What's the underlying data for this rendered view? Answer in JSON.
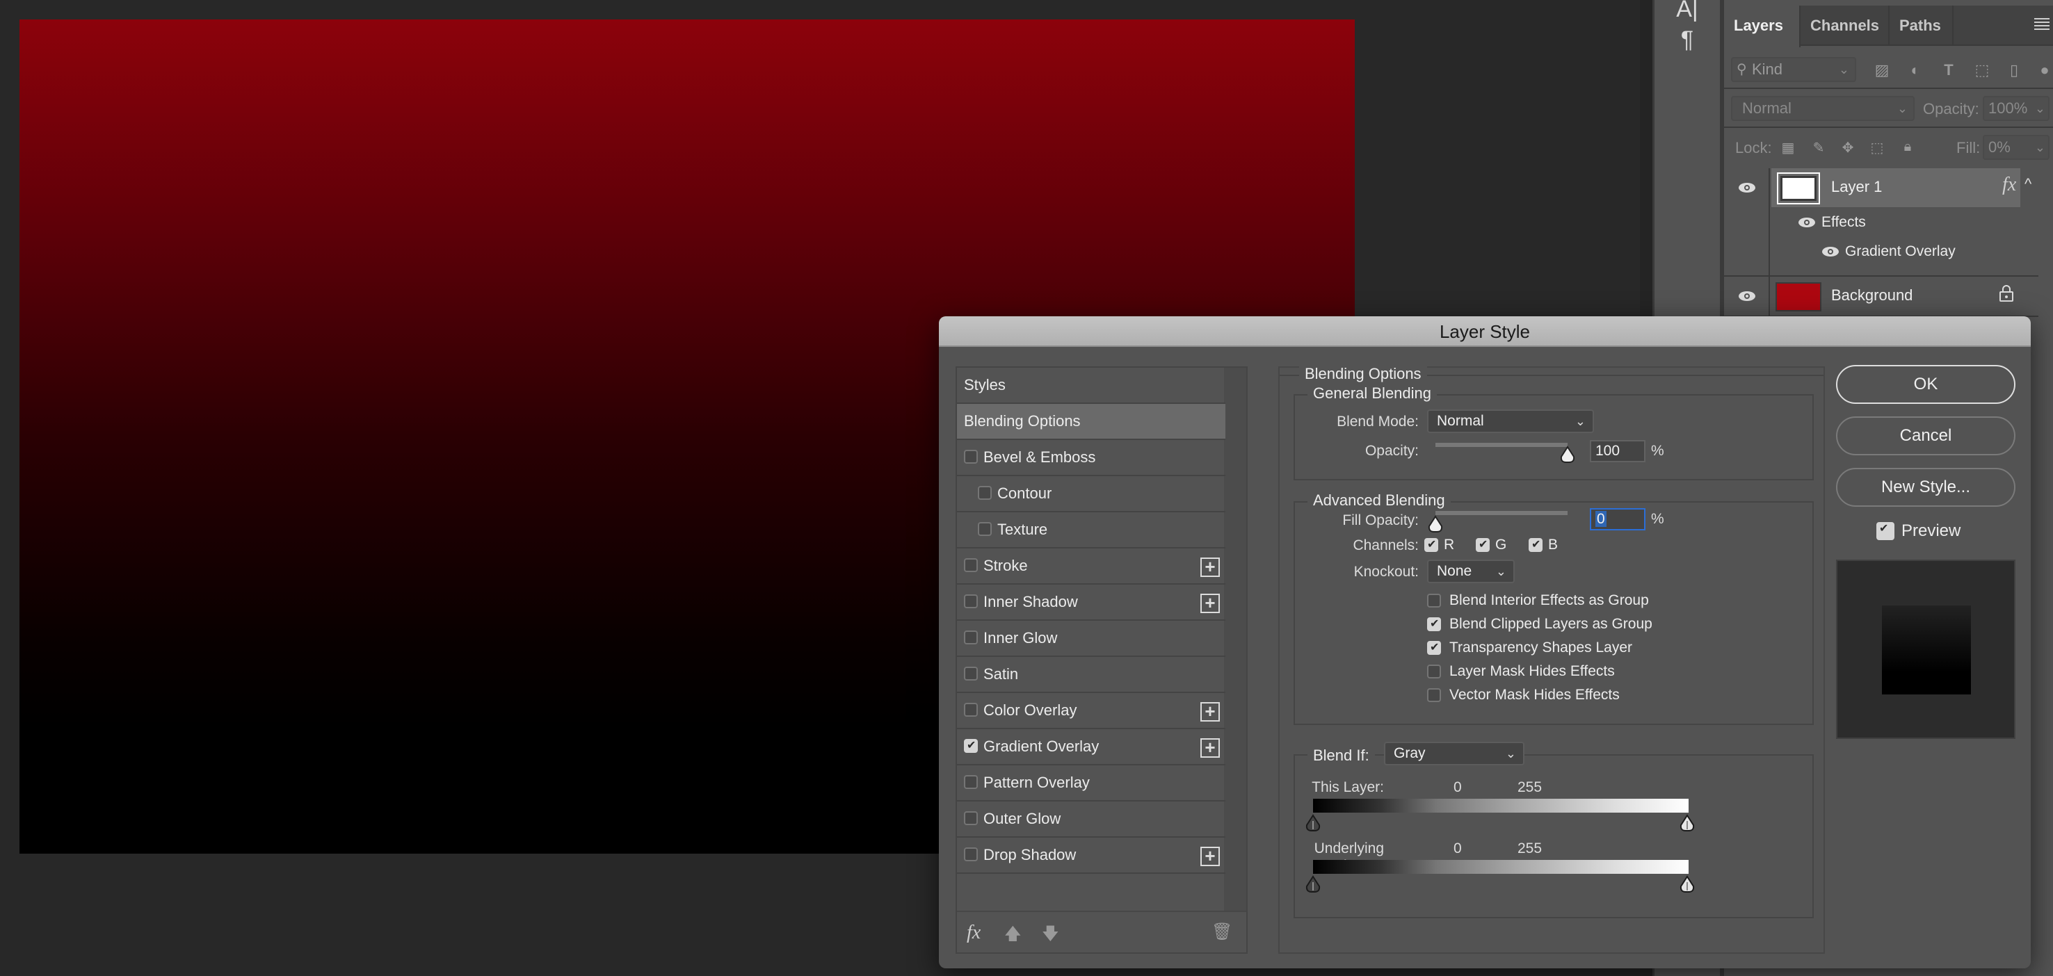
{
  "canvas": {
    "gradient_top_color": "#8c020b",
    "gradient_bottom_color": "#000000"
  },
  "toolstrip": {
    "tools": [
      {
        "name": "character-icon",
        "glyph": "A|"
      },
      {
        "name": "paragraph-icon",
        "glyph": "¶"
      }
    ]
  },
  "layers_panel": {
    "tabs": [
      "Layers",
      "Channels",
      "Paths"
    ],
    "active_tab": "Layers",
    "filter": {
      "label": "Kind"
    },
    "blend_mode": "Normal",
    "opacity_label": "Opacity:",
    "opacity_value": "100%",
    "lock_label": "Lock:",
    "fill_label": "Fill:",
    "fill_value": "0%",
    "layers": [
      {
        "name": "Layer 1",
        "thumb_color": "#ffffff",
        "has_fx": true,
        "fx_label": "fx",
        "selected": true
      },
      {
        "name": "Effects",
        "sub": true
      },
      {
        "name": "Gradient Overlay",
        "sub": true
      },
      {
        "name": "Background",
        "thumb_color": "#ad0710",
        "locked": true
      }
    ]
  },
  "dialog": {
    "title": "Layer Style",
    "styles": [
      {
        "label": "Styles",
        "checkbox": false,
        "indent": 0,
        "plus": false
      },
      {
        "label": "Blending Options",
        "checkbox": false,
        "indent": 0,
        "plus": false,
        "selected": true
      },
      {
        "label": "Bevel & Emboss",
        "checkbox": true,
        "checked": false,
        "indent": 0,
        "plus": false
      },
      {
        "label": "Contour",
        "checkbox": true,
        "checked": false,
        "indent": 1,
        "plus": false
      },
      {
        "label": "Texture",
        "checkbox": true,
        "checked": false,
        "indent": 1,
        "plus": false
      },
      {
        "label": "Stroke",
        "checkbox": true,
        "checked": false,
        "indent": 0,
        "plus": true
      },
      {
        "label": "Inner Shadow",
        "checkbox": true,
        "checked": false,
        "indent": 0,
        "plus": true
      },
      {
        "label": "Inner Glow",
        "checkbox": true,
        "checked": false,
        "indent": 0,
        "plus": false
      },
      {
        "label": "Satin",
        "checkbox": true,
        "checked": false,
        "indent": 0,
        "plus": false
      },
      {
        "label": "Color Overlay",
        "checkbox": true,
        "checked": false,
        "indent": 0,
        "plus": true
      },
      {
        "label": "Gradient Overlay",
        "checkbox": true,
        "checked": true,
        "indent": 0,
        "plus": true
      },
      {
        "label": "Pattern Overlay",
        "checkbox": true,
        "checked": false,
        "indent": 0,
        "plus": false
      },
      {
        "label": "Outer Glow",
        "checkbox": true,
        "checked": false,
        "indent": 0,
        "plus": false
      },
      {
        "label": "Drop Shadow",
        "checkbox": true,
        "checked": false,
        "indent": 0,
        "plus": true
      }
    ],
    "footer": {
      "fx": "fx"
    },
    "blending_options": {
      "title": "Blending Options",
      "general": {
        "title": "General Blending",
        "blend_mode_label": "Blend Mode:",
        "blend_mode": "Normal",
        "opacity_label": "Opacity:",
        "opacity": "100",
        "opacity_fraction": 1.0,
        "pct": "%"
      },
      "advanced": {
        "title": "Advanced Blending",
        "fill_opacity_label": "Fill Opacity:",
        "fill_opacity": "0",
        "fill_fraction": 0.0,
        "pct": "%",
        "channels_label": "Channels:",
        "channels": [
          {
            "label": "R",
            "checked": true
          },
          {
            "label": "G",
            "checked": true
          },
          {
            "label": "B",
            "checked": true
          }
        ],
        "knockout_label": "Knockout:",
        "knockout": "None",
        "options": [
          {
            "label": "Blend Interior Effects as Group",
            "checked": false
          },
          {
            "label": "Blend Clipped Layers as Group",
            "checked": true
          },
          {
            "label": "Transparency Shapes Layer",
            "checked": true
          },
          {
            "label": "Layer Mask Hides Effects",
            "checked": false
          },
          {
            "label": "Vector Mask Hides Effects",
            "checked": false
          }
        ]
      },
      "blend_if": {
        "label": "Blend If:",
        "value": "Gray",
        "this_layer_label": "This Layer:",
        "this_layer_low": "0",
        "this_layer_high": "255",
        "underlying_label": "Underlying Layer:",
        "underlying_low": "0",
        "underlying_high": "255"
      }
    },
    "buttons": {
      "ok": "OK",
      "cancel": "Cancel",
      "new_style": "New Style..."
    },
    "preview": {
      "label": "Preview",
      "checked": true
    }
  }
}
